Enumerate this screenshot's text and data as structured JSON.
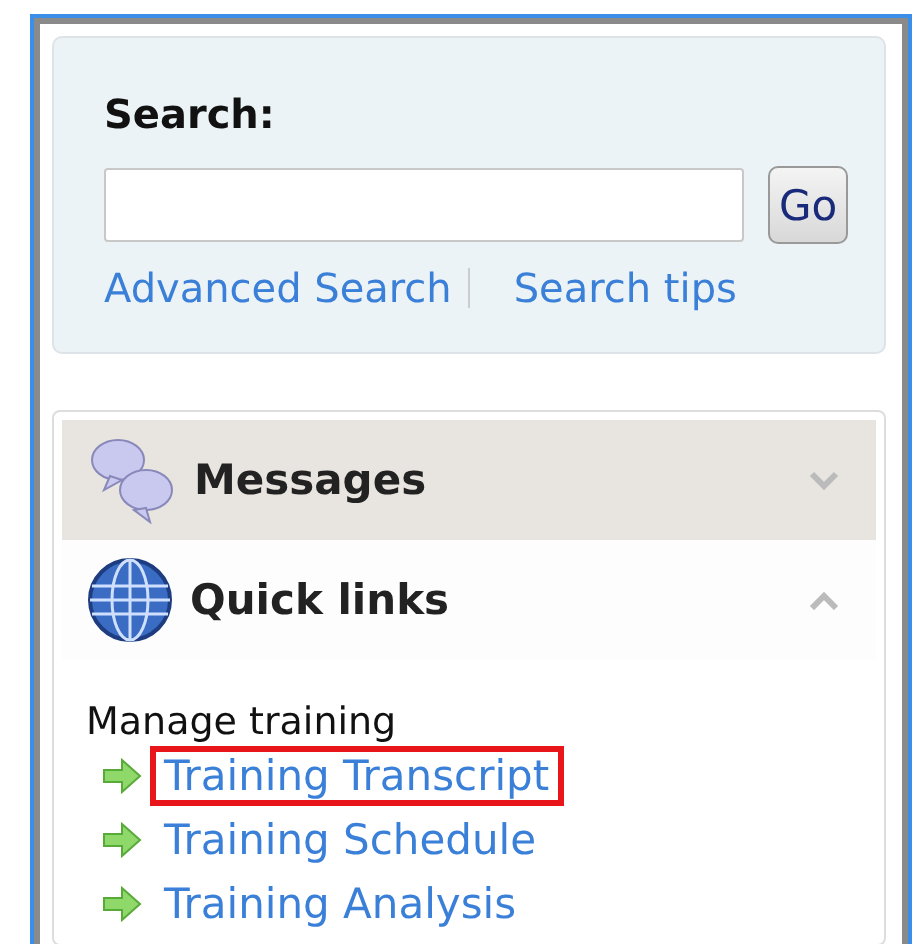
{
  "search": {
    "label": "Search:",
    "button": "Go",
    "links": [
      {
        "label": "Advanced Search"
      },
      {
        "label": "Search tips"
      }
    ]
  },
  "sections": [
    {
      "title": "Messages",
      "kind": "messages",
      "expanded": false
    },
    {
      "title": "Quick links",
      "kind": "globe",
      "expanded": true,
      "group": "Manage training",
      "links": [
        {
          "label": "Training Transcript",
          "highlighted": true
        },
        {
          "label": "Training Schedule",
          "highlighted": false
        },
        {
          "label": "Training Analysis",
          "highlighted": false
        }
      ]
    }
  ]
}
